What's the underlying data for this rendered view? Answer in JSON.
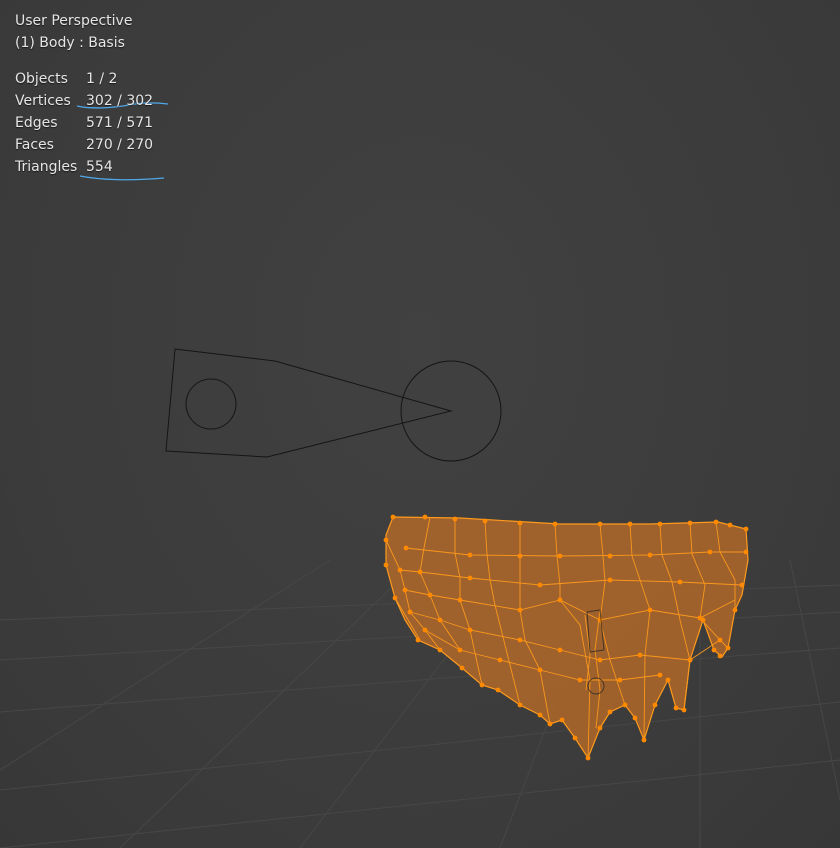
{
  "viewport": {
    "view_label": "User Perspective",
    "object_label": "(1) Body : Basis"
  },
  "stats": [
    {
      "label": "Objects",
      "value": "1 / 2"
    },
    {
      "label": "Vertices",
      "value": "302 / 302"
    },
    {
      "label": "Edges",
      "value": "571 / 571"
    },
    {
      "label": "Faces",
      "value": "270 / 270"
    },
    {
      "label": "Triangles",
      "value": "554"
    }
  ],
  "colors": {
    "background": "#3d3d3d",
    "grid": "#4a4a4a",
    "mesh_fill": "#a8652a",
    "mesh_edge": "#ff9a1c",
    "vertex": "#ff8a00",
    "annotation_underline": "#4fa8e8",
    "empty_outline": "#111111"
  },
  "icons": [
    "light-empty-outline",
    "edit-mesh-body"
  ]
}
